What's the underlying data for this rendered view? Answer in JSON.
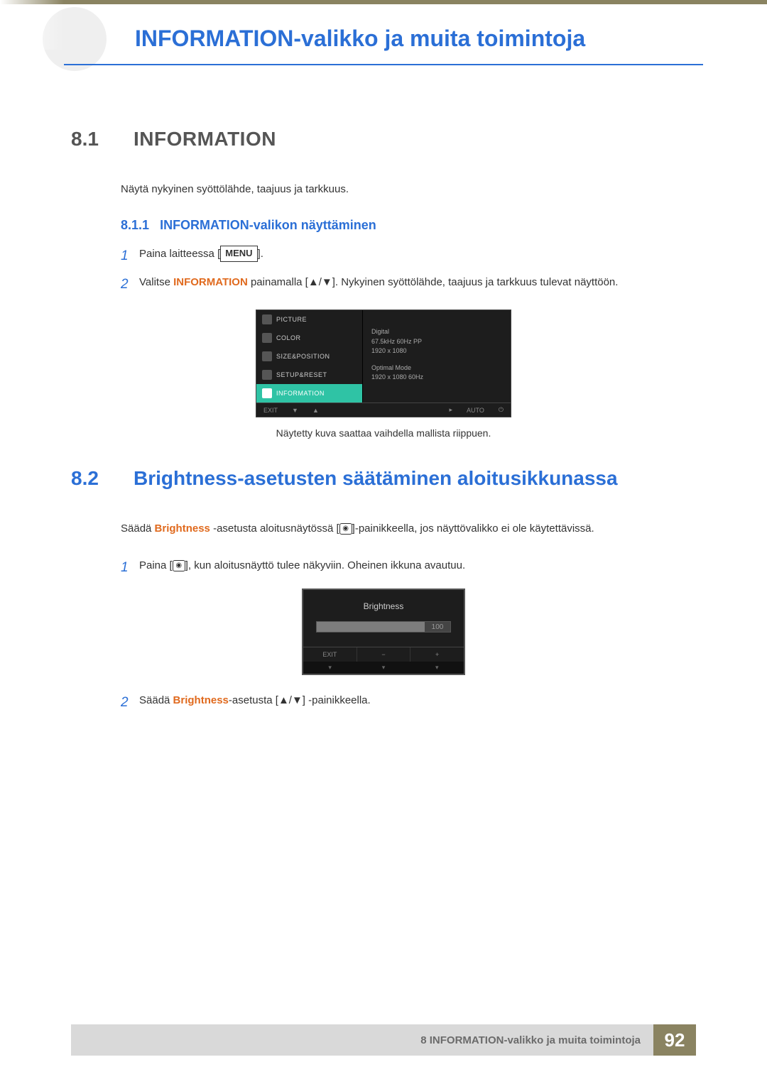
{
  "header": {
    "chapter_title": "INFORMATION-valikko ja muita toimintoja"
  },
  "section1": {
    "num": "8.1",
    "title": "INFORMATION",
    "intro": "Näytä nykyinen syöttölähde, taajuus ja tarkkuus.",
    "sub_num": "8.1.1",
    "sub_title": "INFORMATION-valikon näyttäminen",
    "step1_pre": "Paina laitteessa [",
    "step1_menu": "MENU",
    "step1_post": "].",
    "step2_pre": "Valitse ",
    "step2_key": "INFORMATION",
    "step2_mid": " painamalla [▲/▼]. Nykyinen syöttölähde, taajuus ja tarkkuus tulevat näyttöön.",
    "caption": "Näytetty kuva saattaa vaihdella mallista riippuen."
  },
  "osd1": {
    "items": [
      "PICTURE",
      "COLOR",
      "SIZE&POSITION",
      "SETUP&RESET",
      "INFORMATION"
    ],
    "right_line1": "Digital",
    "right_line2": "67.5kHz 60Hz PP",
    "right_line3": "1920 x 1080",
    "right_line4": "Optimal Mode",
    "right_line5": "1920 x 1080 60Hz",
    "foot_exit": "EXIT",
    "foot_auto": "AUTO"
  },
  "section2": {
    "num": "8.2",
    "title": "Brightness-asetusten säätäminen aloitusikkunassa",
    "intro_pre": "Säädä ",
    "intro_key": "Brightness",
    "intro_post": " -asetusta aloitusnäytössä [",
    "intro_btn": "◉",
    "intro_post2": "]-painikkeella, jos näyttövalikko ei ole käytettävissä.",
    "step1_pre": "Paina [",
    "step1_btn": "◉",
    "step1_post": "], kun aloitusnäyttö tulee näkyviin. Oheinen ikkuna avautuu.",
    "step2_pre": "Säädä ",
    "step2_key": "Brightness",
    "step2_post": "-asetusta [▲/▼] -painikkeella."
  },
  "osd2": {
    "title": "Brightness",
    "value": "100",
    "exit": "EXIT",
    "minus": "−",
    "plus": "+"
  },
  "footer": {
    "text": "8 INFORMATION-valikko ja muita toimintoja",
    "page": "92"
  }
}
